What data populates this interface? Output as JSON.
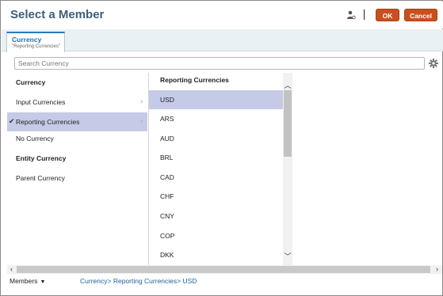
{
  "dialog": {
    "title": "Select a Member",
    "ok_label": "OK",
    "cancel_label": "Cancel",
    "accent": "#c8501e"
  },
  "tab": {
    "title": "Currency",
    "subtitle": "\"Reporting Currencies\""
  },
  "search": {
    "placeholder": "Search Currency"
  },
  "left_items": [
    {
      "label": "Currency",
      "kind": "header"
    },
    {
      "label": "Input Currencies",
      "kind": "item",
      "expandable": true
    },
    {
      "label": "Reporting Currencies",
      "kind": "item",
      "selected": true,
      "checked": true,
      "expandable": true
    },
    {
      "label": "No Currency",
      "kind": "item"
    },
    {
      "label": "Entity Currency",
      "kind": "header"
    },
    {
      "label": "Parent Currency",
      "kind": "item"
    }
  ],
  "middle": {
    "header": "Reporting Currencies",
    "items": [
      "USD",
      "ARS",
      "AUD",
      "BRL",
      "CAD",
      "CHF",
      "CNY",
      "COP",
      "DKK"
    ],
    "selected": "USD"
  },
  "footer": {
    "members_label": "Members",
    "breadcrumb": [
      "Currency>",
      "Reporting Currencies>",
      "USD"
    ]
  },
  "colors": {
    "selection": "#c5cbe7",
    "title": "#3d5f7a",
    "link": "#1f5e9a"
  }
}
